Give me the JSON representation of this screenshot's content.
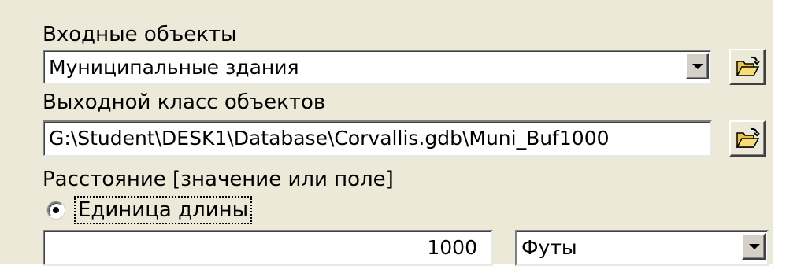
{
  "colors": {
    "dialog_background": "#ECE9D8",
    "field_background": "#FFFFFF",
    "text": "#000000"
  },
  "input_objects": {
    "label": "Входные объекты",
    "selected_value": "Муниципальные здания"
  },
  "output_class": {
    "label": "Выходной класс объектов",
    "value": "G:\\Student\\DESK1\\Database\\Corvallis.gdb\\Muni_Buf1000"
  },
  "distance": {
    "label": "Расстояние [значение или поле]",
    "option_label": "Единица длины",
    "option_selected": true,
    "value": "1000",
    "unit": "Футы"
  },
  "icons": {
    "browse": "open-folder-icon",
    "dropdown": "chevron-down-icon",
    "radio": "radio-selected-icon"
  }
}
